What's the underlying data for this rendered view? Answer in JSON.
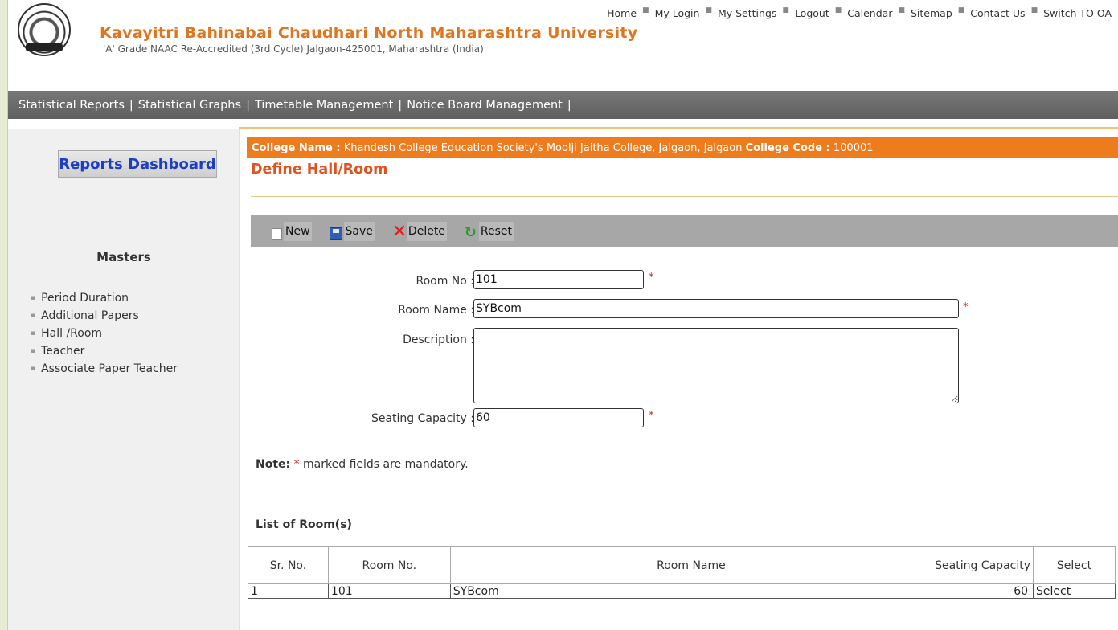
{
  "header": {
    "university_name": "Kavayitri Bahinabai Chaudhari North Maharashtra University",
    "subtitle": "'A' Grade NAAC Re-Accredited (3rd Cycle) Jalgaon-425001, Maharashtra (India)",
    "top_links": [
      "Home",
      "My Login",
      "My Settings",
      "Logout",
      "Calendar",
      "Sitemap",
      "Contact Us",
      "Switch TO OA"
    ]
  },
  "menubar": {
    "items": [
      "Statistical Reports",
      "Statistical Graphs",
      "Timetable Management",
      "Notice Board Management"
    ]
  },
  "sidebar": {
    "dashboard_label": "Reports Dashboard",
    "masters_title": "Masters",
    "items": [
      "Period Duration",
      "Additional Papers",
      "Hall /Room",
      "Teacher",
      "Associate Paper Teacher"
    ]
  },
  "college": {
    "name_label": "College Name :",
    "name_value": "Khandesh College Education Society's Moolji Jaitha College, Jalgaon, Jalgaon",
    "code_label": "College Code :",
    "code_value": "100001"
  },
  "page_title": "Define Hall/Room",
  "toolbar": {
    "new_label": "New",
    "save_label": "Save",
    "delete_label": "Delete",
    "reset_label": "Reset"
  },
  "form": {
    "room_no_label": "Room No :",
    "room_no_value": "101",
    "room_name_label": "Room Name :",
    "room_name_value": "SYBcom",
    "description_label": "Description :",
    "description_value": "",
    "seating_label": "Seating Capacity :",
    "seating_value": "60",
    "required_mark": "*"
  },
  "note": {
    "prefix": "Note:",
    "star": "*",
    "text": "marked fields are mandatory."
  },
  "list": {
    "title": "List of Room(s)",
    "headers": [
      "Sr. No.",
      "Room No.",
      "Room Name",
      "Seating Capacity",
      "Select"
    ],
    "rows": [
      [
        "1",
        "101",
        "SYBcom",
        "60",
        "Select"
      ]
    ]
  },
  "colors": {
    "accent_orange": "#ee7b1c",
    "title_orange": "#e0531e",
    "dashboard_blue": "#1b3ec4",
    "required_red": "#e02020"
  }
}
